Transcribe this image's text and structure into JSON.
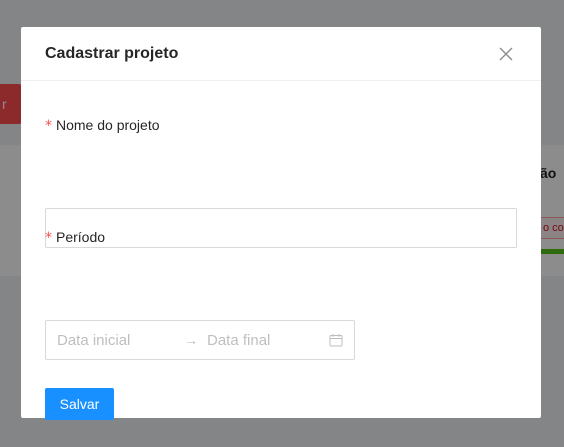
{
  "background": {
    "action_button_fragment": "r",
    "column_header_fragment": "ão",
    "status_tag_fragment": "o co"
  },
  "modal": {
    "title": "Cadastrar projeto",
    "close_glyph": "X",
    "fields": {
      "name": {
        "required_mark": "*",
        "label": "Nome do projeto",
        "value": "",
        "placeholder": ""
      },
      "period": {
        "required_mark": "*",
        "label": "Período",
        "start_placeholder": "Data inicial",
        "end_placeholder": "Data final",
        "separator": "→",
        "icon": "calendar-icon"
      }
    },
    "submit_label": "Salvar"
  },
  "colors": {
    "primary": "#1890ff",
    "required": "#ff4d4f",
    "danger_button": "#ff4d4f",
    "progress": "#52c41a"
  }
}
